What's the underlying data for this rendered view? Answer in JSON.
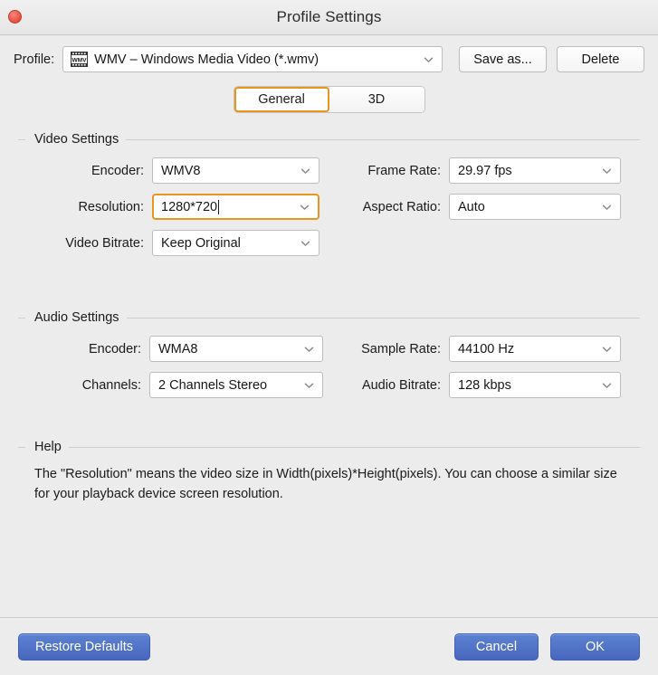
{
  "window": {
    "title": "Profile Settings",
    "close_icon": "close-icon"
  },
  "profile_bar": {
    "label": "Profile:",
    "icon": "wmv-film-icon",
    "value": "WMV – Windows Media Video (*.wmv)",
    "save_as_label": "Save as...",
    "delete_label": "Delete"
  },
  "tabs": [
    {
      "label": "General",
      "active": true
    },
    {
      "label": "3D",
      "active": false
    }
  ],
  "video_settings": {
    "title": "Video Settings",
    "encoder": {
      "label": "Encoder:",
      "value": "WMV8"
    },
    "resolution": {
      "label": "Resolution:",
      "value": "1280*720",
      "focused": true
    },
    "video_bitrate": {
      "label": "Video Bitrate:",
      "value": "Keep Original"
    },
    "frame_rate": {
      "label": "Frame Rate:",
      "value": "29.97 fps"
    },
    "aspect_ratio": {
      "label": "Aspect Ratio:",
      "value": "Auto"
    }
  },
  "audio_settings": {
    "title": "Audio Settings",
    "encoder": {
      "label": "Encoder:",
      "value": "WMA8"
    },
    "channels": {
      "label": "Channels:",
      "value": "2 Channels Stereo"
    },
    "sample_rate": {
      "label": "Sample Rate:",
      "value": "44100 Hz"
    },
    "audio_bitrate": {
      "label": "Audio Bitrate:",
      "value": "128 kbps"
    }
  },
  "help": {
    "title": "Help",
    "text": "The \"Resolution\" means the video size in Width(pixels)*Height(pixels).  You can choose a similar size for your playback device screen resolution."
  },
  "footer": {
    "restore_defaults_label": "Restore Defaults",
    "cancel_label": "Cancel",
    "ok_label": "OK"
  },
  "colors": {
    "accent_orange": "#e8961e",
    "button_blue": "#4767bd",
    "background": "#ececec",
    "close_red": "#ef5f50"
  }
}
